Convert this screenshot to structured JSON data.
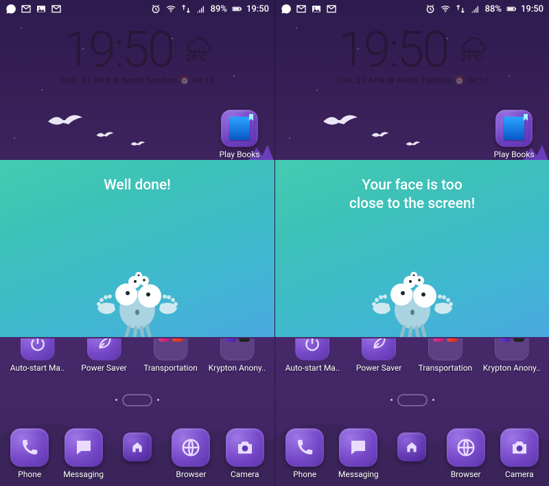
{
  "screens": [
    {
      "status": {
        "battery_pct": "89%",
        "time": "19:50"
      },
      "overlay_msg": "Well done!"
    },
    {
      "status": {
        "battery_pct": "88%",
        "time": "19:50"
      },
      "overlay_msg": "Your face is too\nclose to the screen!"
    }
  ],
  "clock": {
    "big_time": "19:50",
    "temp": "29°C",
    "date": "THU, 21 APR",
    "loc_prefix": "⊚",
    "loc": "North Tambun",
    "alarm_icon": "⏰",
    "alarm": "04:15"
  },
  "playbooks_label": "Play Books",
  "row_apps": [
    {
      "label": "Auto-start Ma..",
      "kind": "icon",
      "glyph": "power"
    },
    {
      "label": "Power Saver",
      "kind": "icon",
      "glyph": "leaf"
    },
    {
      "label": "Transportation",
      "kind": "folder",
      "minis": [
        "m-pnk",
        "m-red",
        "",
        ""
      ]
    },
    {
      "label": "Krypton Anony..",
      "kind": "folder",
      "minis": [
        "m-prp",
        "m-blk",
        "",
        ""
      ]
    }
  ],
  "dock": [
    {
      "label": "Phone",
      "glyph": "phone"
    },
    {
      "label": "Messaging",
      "glyph": "msg"
    },
    {
      "label": "",
      "glyph": "drawer"
    },
    {
      "label": "Browser",
      "glyph": "globe"
    },
    {
      "label": "Camera",
      "glyph": "camera"
    }
  ]
}
